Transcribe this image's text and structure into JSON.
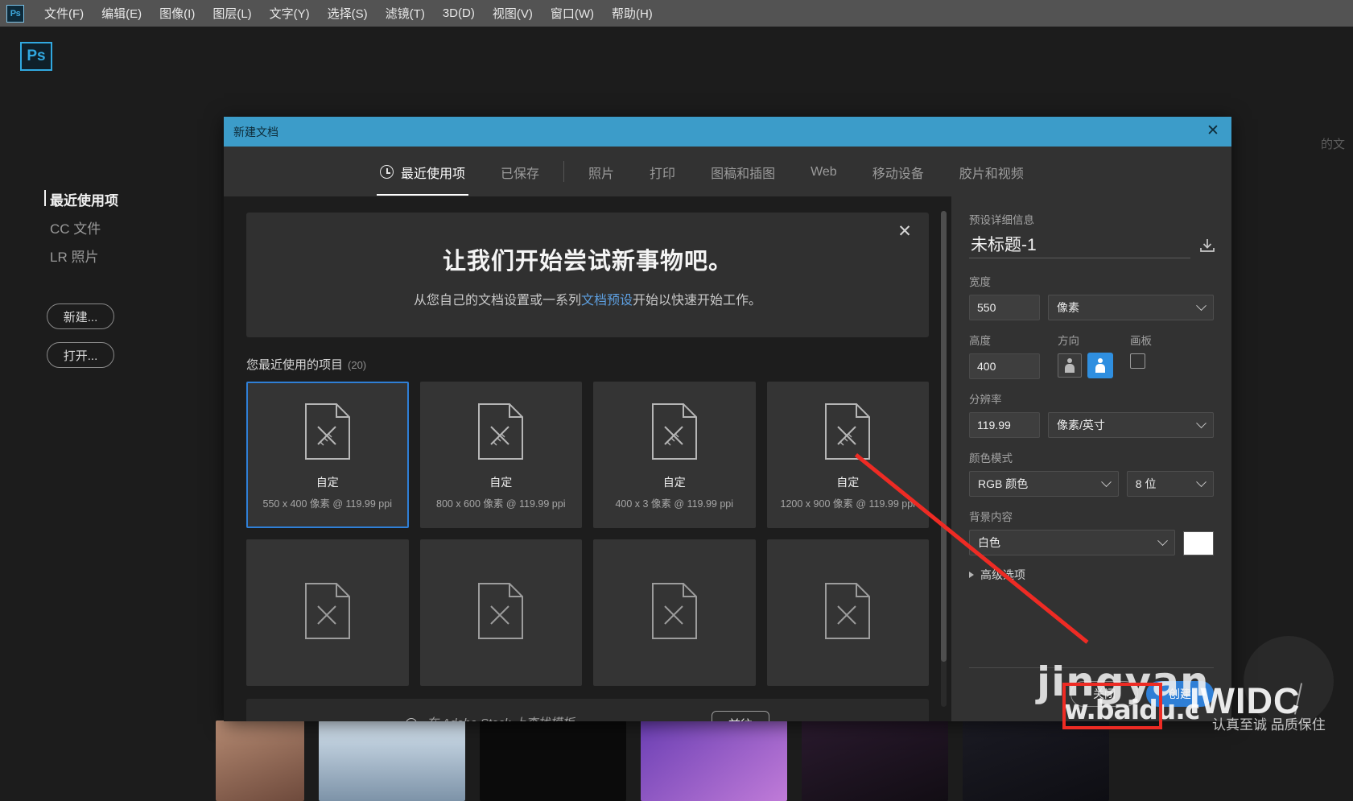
{
  "menubar": {
    "logo": "Ps",
    "items": [
      {
        "label": "文件(F)"
      },
      {
        "label": "编辑(E)"
      },
      {
        "label": "图像(I)"
      },
      {
        "label": "图层(L)"
      },
      {
        "label": "文字(Y)"
      },
      {
        "label": "选择(S)"
      },
      {
        "label": "滤镜(T)"
      },
      {
        "label": "3D(D)"
      },
      {
        "label": "视图(V)"
      },
      {
        "label": "窗口(W)"
      },
      {
        "label": "帮助(H)"
      }
    ]
  },
  "home": {
    "logo": "Ps",
    "ghost_text": "的文",
    "sidebar": {
      "links": [
        {
          "label": "最近使用项",
          "active": true
        },
        {
          "label": "CC 文件",
          "active": false
        },
        {
          "label": "LR 照片",
          "active": false
        }
      ],
      "buttons": [
        {
          "label": "新建..."
        },
        {
          "label": "打开..."
        }
      ]
    }
  },
  "dialog": {
    "title": "新建文档",
    "close_icon": "close-icon",
    "tabs": [
      {
        "label": "最近使用项",
        "icon": "clock-icon",
        "active": true
      },
      {
        "label": "已保存",
        "active": false
      },
      {
        "label": "照片",
        "active": false
      },
      {
        "label": "打印",
        "active": false
      },
      {
        "label": "图稿和插图",
        "active": false
      },
      {
        "label": "Web",
        "active": false
      },
      {
        "label": "移动设备",
        "active": false
      },
      {
        "label": "胶片和视频",
        "active": false
      }
    ],
    "banner": {
      "heading": "让我们开始尝试新事物吧。",
      "sub_before": "从您自己的文档设置或一系列",
      "sub_link": "文档预设",
      "sub_after": "开始以快速开始工作。",
      "close_icon": "close-icon"
    },
    "recent": {
      "heading": "您最近使用的项目",
      "count": "(20)",
      "cards": [
        {
          "name": "自定",
          "dims": "550 x 400 像素 @ 119.99 ppi",
          "selected": true
        },
        {
          "name": "自定",
          "dims": "800 x 600 像素 @ 119.99 ppi",
          "selected": false
        },
        {
          "name": "自定",
          "dims": "400 x 3 像素 @ 119.99 ppi",
          "selected": false
        },
        {
          "name": "自定",
          "dims": "1200 x 900 像素 @ 119.99 ppi",
          "selected": false
        }
      ]
    },
    "stock": {
      "placeholder": "在 Adobe Stock 上查找模板",
      "go_label": "前往",
      "search_icon": "search-icon"
    },
    "preset": {
      "section_label": "预设详细信息",
      "name_value": "未标题-1",
      "save_icon": "save-preset-icon",
      "width": {
        "label": "宽度",
        "value": "550",
        "unit": "像素"
      },
      "height": {
        "label": "高度",
        "value": "400"
      },
      "orientation": {
        "label": "方向",
        "portrait": "纵向",
        "landscape": "横向",
        "selected": "landscape"
      },
      "artboard": {
        "label": "画板",
        "checked": false
      },
      "resolution": {
        "label": "分辨率",
        "value": "119.99",
        "unit": "像素/英寸"
      },
      "color_mode": {
        "label": "颜色模式",
        "value": "RGB 颜色",
        "depth": "8 位"
      },
      "background": {
        "label": "背景内容",
        "value": "白色",
        "swatch_color": "#ffffff"
      },
      "advanced": {
        "label": "高级选项"
      },
      "footer": {
        "create_label": "创建",
        "close_label": "关闭"
      }
    }
  },
  "annotation": {
    "line_color": "#ee2b24",
    "box_color": "#ee2b24"
  },
  "watermarks": {
    "baidu_top": "jingyan",
    "baidu_bottom": "w.baidu.c",
    "iwidc": "IWIDC",
    "slogan": "认真至诚 品质保住"
  },
  "colors": {
    "accent_blue": "#2f7fd6",
    "titlebar_blue": "#3c9cc9",
    "dialog_bg": "#323232",
    "content_bg": "#1d1d1d",
    "annotation_red": "#ee2b24"
  }
}
